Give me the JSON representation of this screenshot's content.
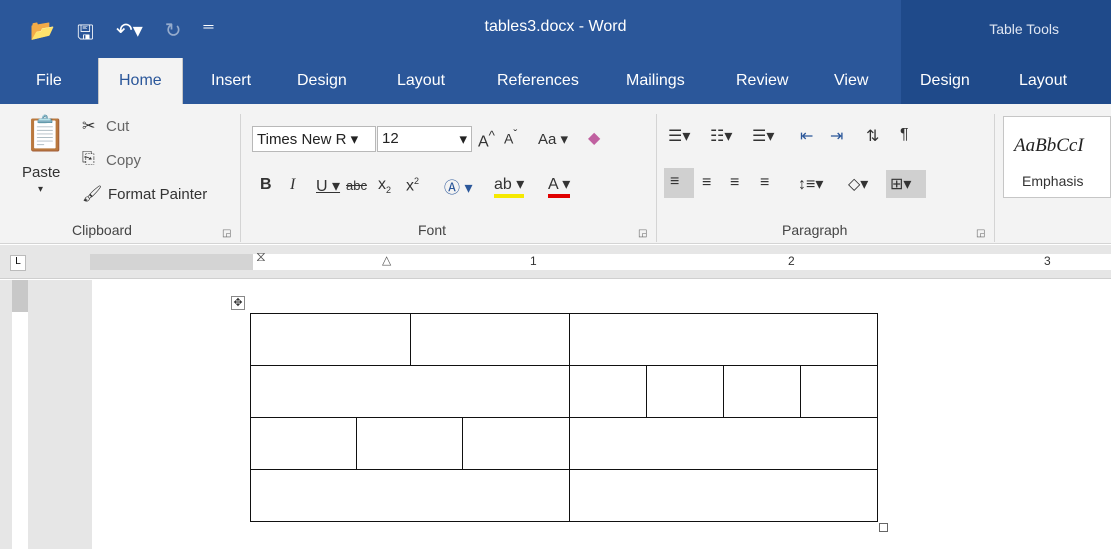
{
  "window": {
    "title": "tables3.docx - Word",
    "context_label": "Table Tools"
  },
  "qat": {
    "open_icon": "folder-open-icon",
    "save_icon": "save-icon",
    "undo_icon": "undo-icon",
    "redo_icon": "redo-icon",
    "customize_icon": "customize-qat-icon"
  },
  "tabs": [
    "File",
    "Home",
    "Insert",
    "Design",
    "Layout",
    "References",
    "Mailings",
    "Review",
    "View",
    "Design",
    "Layout"
  ],
  "ribbon": {
    "clipboard": {
      "paste": "Paste",
      "cut": "Cut",
      "copy": "Copy",
      "format_painter": "Format Painter",
      "label": "Clipboard"
    },
    "font": {
      "face": "Times New R",
      "size": "12",
      "case": "Aa",
      "label": "Font"
    },
    "paragraph": {
      "label": "Paragraph"
    },
    "styles": {
      "sample": "AaBbCcI",
      "name": "Emphasis"
    }
  },
  "ruler": {
    "marks": [
      "1",
      "2",
      "3"
    ]
  },
  "colors": {
    "accent": "#2b579a",
    "context_tab": "#1f4a8a"
  }
}
